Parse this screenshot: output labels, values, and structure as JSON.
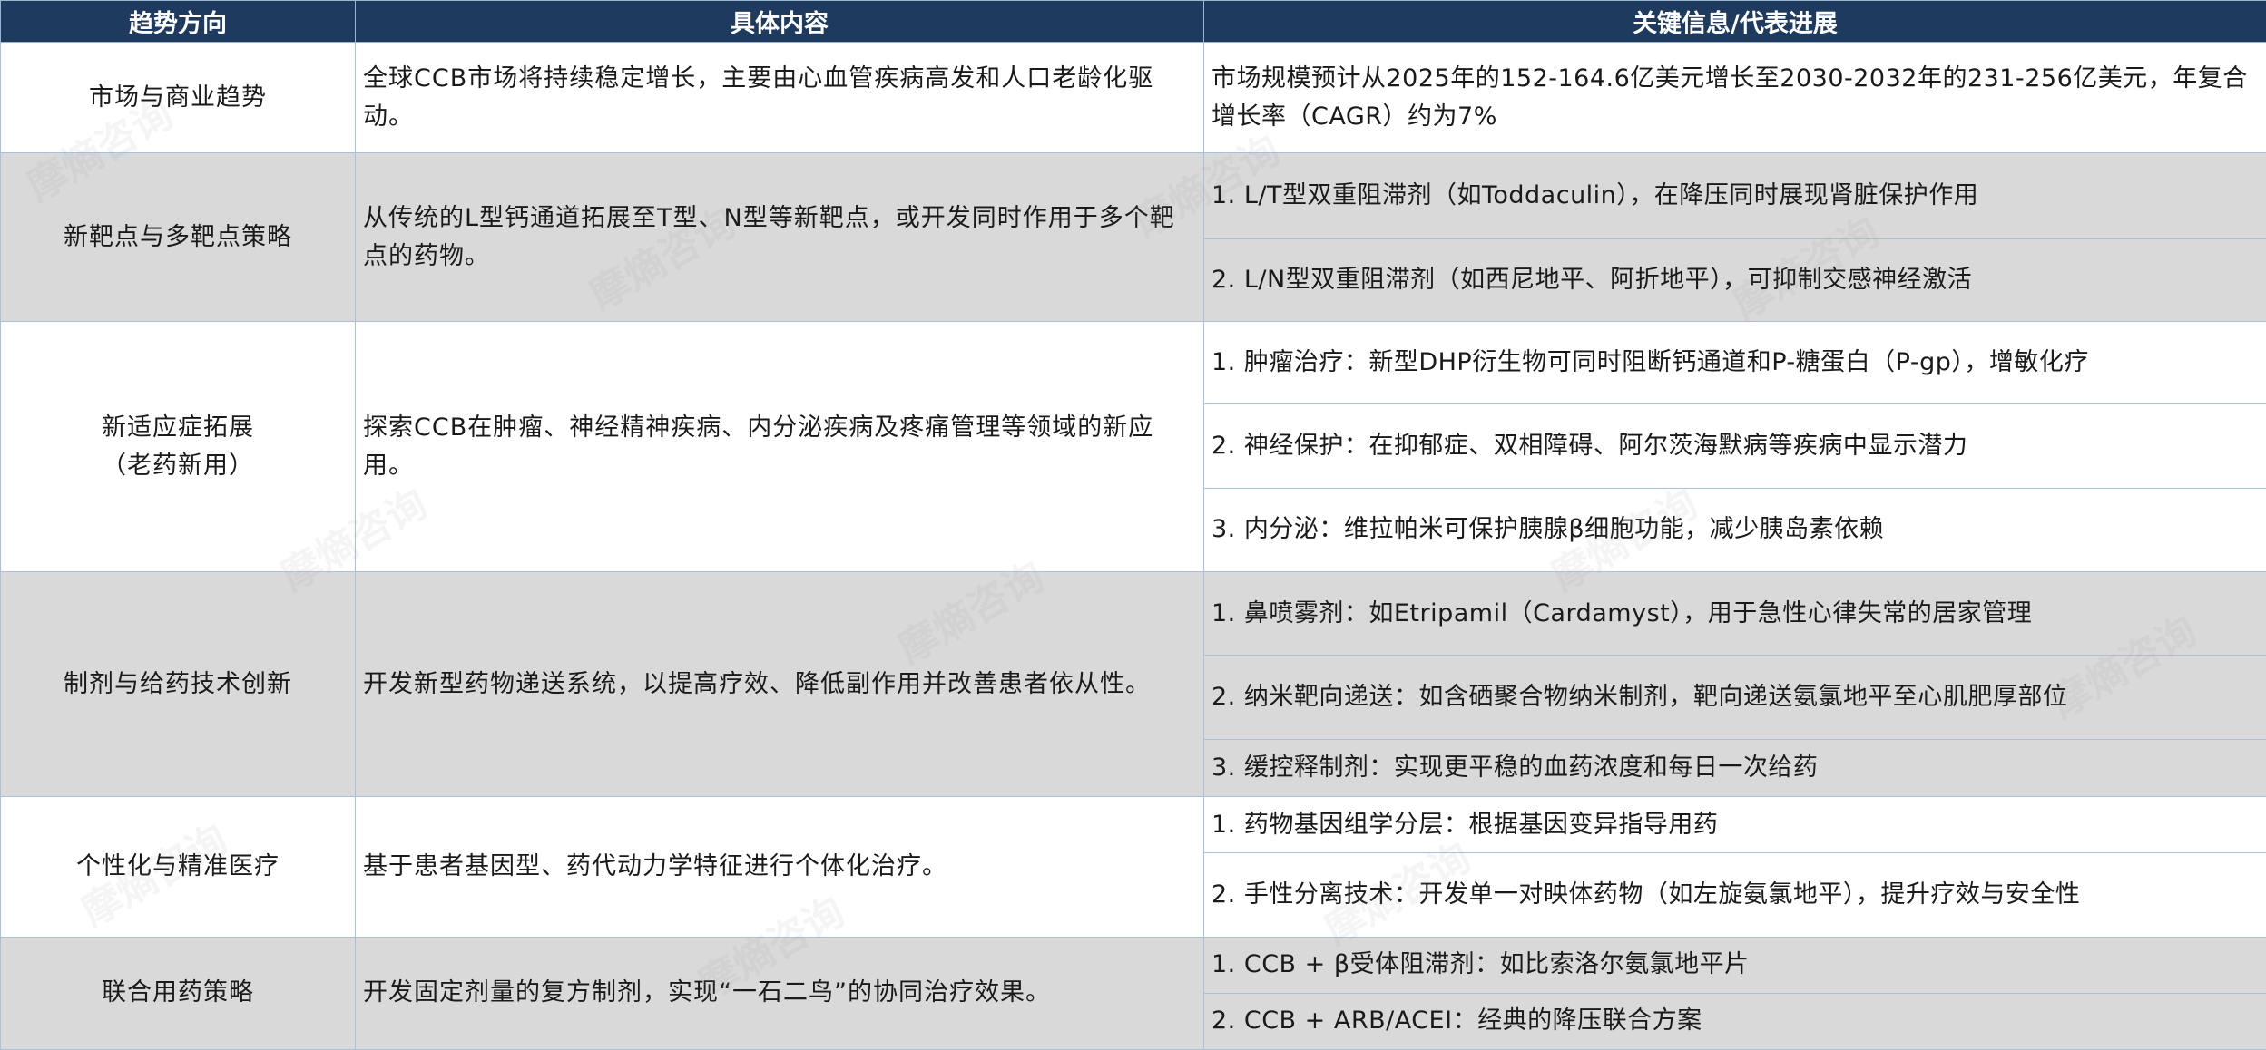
{
  "header": {
    "col1": "趋势方向",
    "col2": "具体内容",
    "col3": "关键信息/代表进展"
  },
  "rows": [
    {
      "direction": "市场与商业趋势",
      "content": "全球CCB市场将持续稳定增长，主要由心血管疾病高发和人口老龄化驱动。",
      "items": [
        "市场规模预计从2025年的152-164.6亿美元增长至2030-2032年的231-256亿美元，年复合增长率（CAGR）约为7%"
      ]
    },
    {
      "direction": "新靶点与多靶点策略",
      "content": "从传统的L型钙通道拓展至T型、N型等新靶点，或开发同时作用于多个靶点的药物。",
      "items": [
        "1. L/T型双重阻滞剂（如Toddaculin），在降压同时展现肾脏保护作用",
        "2. L/N型双重阻滞剂（如西尼地平、阿折地平），可抑制交感神经激活"
      ]
    },
    {
      "direction_line1": "新适应症拓展",
      "direction_line2": "（老药新用）",
      "content": "探索CCB在肿瘤、神经精神疾病、内分泌疾病及疼痛管理等领域的新应用。",
      "items": [
        "1. 肿瘤治疗：新型DHP衍生物可同时阻断钙通道和P-糖蛋白（P-gp），增敏化疗",
        "2. 神经保护：在抑郁症、双相障碍、阿尔茨海默病等疾病中显示潜力",
        "3. 内分泌：维拉帕米可保护胰腺β细胞功能，减少胰岛素依赖"
      ]
    },
    {
      "direction": "制剂与给药技术创新",
      "content": "开发新型药物递送系统，以提高疗效、降低副作用并改善患者依从性。",
      "items": [
        "1. 鼻喷雾剂：如Etripamil（Cardamyst），用于急性心律失常的居家管理",
        "2. 纳米靶向递送：如含硒聚合物纳米制剂，靶向递送氨氯地平至心肌肥厚部位",
        "3. 缓控释制剂：实现更平稳的血药浓度和每日一次给药"
      ]
    },
    {
      "direction": "个性化与精准医疗",
      "content": "基于患者基因型、药代动力学特征进行个体化治疗。",
      "items": [
        "1. 药物基因组学分层：根据基因变异指导用药",
        "2. 手性分离技术：开发单一对映体药物（如左旋氨氯地平），提升疗效与安全性"
      ]
    },
    {
      "direction": "联合用药策略",
      "content": "开发固定剂量的复方制剂，实现“一石二鸟”的协同治疗效果。",
      "items": [
        "1. CCB + β受体阻滞剂：如比索洛尔氨氯地平片",
        "2. CCB + ARB/ACEI：经典的降压联合方案"
      ]
    }
  ],
  "watermark": "摩熵咨询",
  "colors": {
    "header_bg": "#1f3a5f",
    "grey_row": "#d9d9d9",
    "border": "#a9c1dd"
  }
}
